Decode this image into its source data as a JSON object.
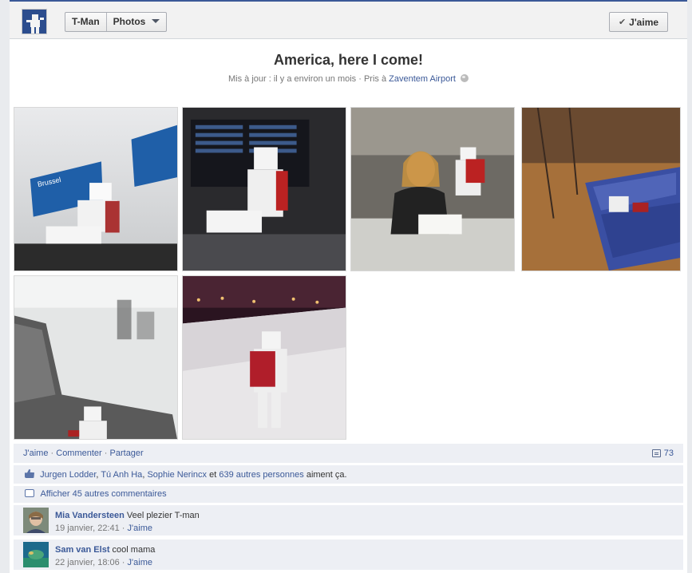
{
  "header": {
    "page_name": "T-Man",
    "section": "Photos",
    "like_button": "J'aime",
    "like_check_icon": "check-icon"
  },
  "album": {
    "title": "America, here I come!",
    "meta_prefix": "Mis à jour : il y a environ un mois · Pris à",
    "location": "Zaventem Airport",
    "privacy_icon": "globe-icon"
  },
  "photos": [
    {
      "name": "photo-zaventem-sign",
      "desc": "T-Man figure in front of Brussel / Zaventem highway signs"
    },
    {
      "name": "photo-departures-board",
      "desc": "T-Man figure near airport departures board"
    },
    {
      "name": "photo-check-in-desk",
      "desc": "Check-in agent smiling with T-Man figure"
    },
    {
      "name": "photo-security-trays",
      "desc": "Security trays with T-Man figure"
    },
    {
      "name": "photo-waiting-seats",
      "desc": "T-Man figure on airport waiting seats"
    },
    {
      "name": "photo-night-tarmac",
      "desc": "T-Man figure with backpack looking at tarmac at night"
    }
  ],
  "feedback": {
    "actions": [
      "J'aime",
      "Commenter",
      "Partager"
    ],
    "comment_count": "73",
    "likers": [
      "Jurgen Lodder",
      "Tú Anh Ha",
      "Sophie Nerincx"
    ],
    "likers_connector": "et",
    "others": "639 autres personnes",
    "likes_suffix": "aiment ça.",
    "more_comments": "Afficher 45 autres commentaires"
  },
  "comments": [
    {
      "author": "Mia Vandersteen",
      "text": "Veel plezier T-man",
      "time": "19 janvier, 22:41",
      "like": "J'aime"
    },
    {
      "author": "Sam van Elst",
      "text": "cool mama",
      "time": "22 janvier, 18:06",
      "like": "J'aime"
    }
  ],
  "colors": {
    "link": "#3b5998",
    "feedback_bg": "#edeff4",
    "page_bg": "#e9ebee"
  }
}
